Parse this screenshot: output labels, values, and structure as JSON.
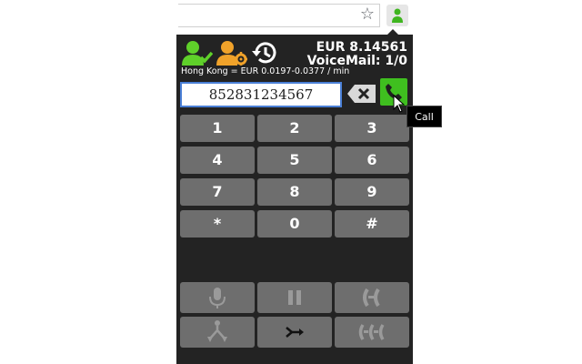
{
  "browser": {
    "star_icon": "star-icon",
    "extension_icon": "phone-extension-icon"
  },
  "header": {
    "icons": [
      "contacts-check-icon",
      "contact-settings-icon",
      "history-icon"
    ],
    "balance": "EUR 8.14561",
    "voicemail": "VoiceMail: 1/0",
    "rate": "Hong Kong = EUR 0.0197-0.0377 / min"
  },
  "dialer": {
    "number_value": "852831234567",
    "backspace_icon": "backspace-icon",
    "call_icon": "phone-call-icon",
    "tooltip": "Call"
  },
  "keypad": {
    "keys": [
      "1",
      "2",
      "3",
      "4",
      "5",
      "6",
      "7",
      "8",
      "9",
      "*",
      "0",
      "#"
    ]
  },
  "controls": {
    "buttons": [
      "microphone-icon",
      "pause-icon",
      "transfer-icon",
      "merge-icon",
      "forward-icon",
      "conference-icon"
    ]
  },
  "colors": {
    "popup_bg": "#232323",
    "key_bg": "#6e6e6e",
    "call_green": "#3fbf1f",
    "user_green": "#5fd02a",
    "user_orange": "#f0a22a",
    "input_border": "#4a7fd6"
  }
}
